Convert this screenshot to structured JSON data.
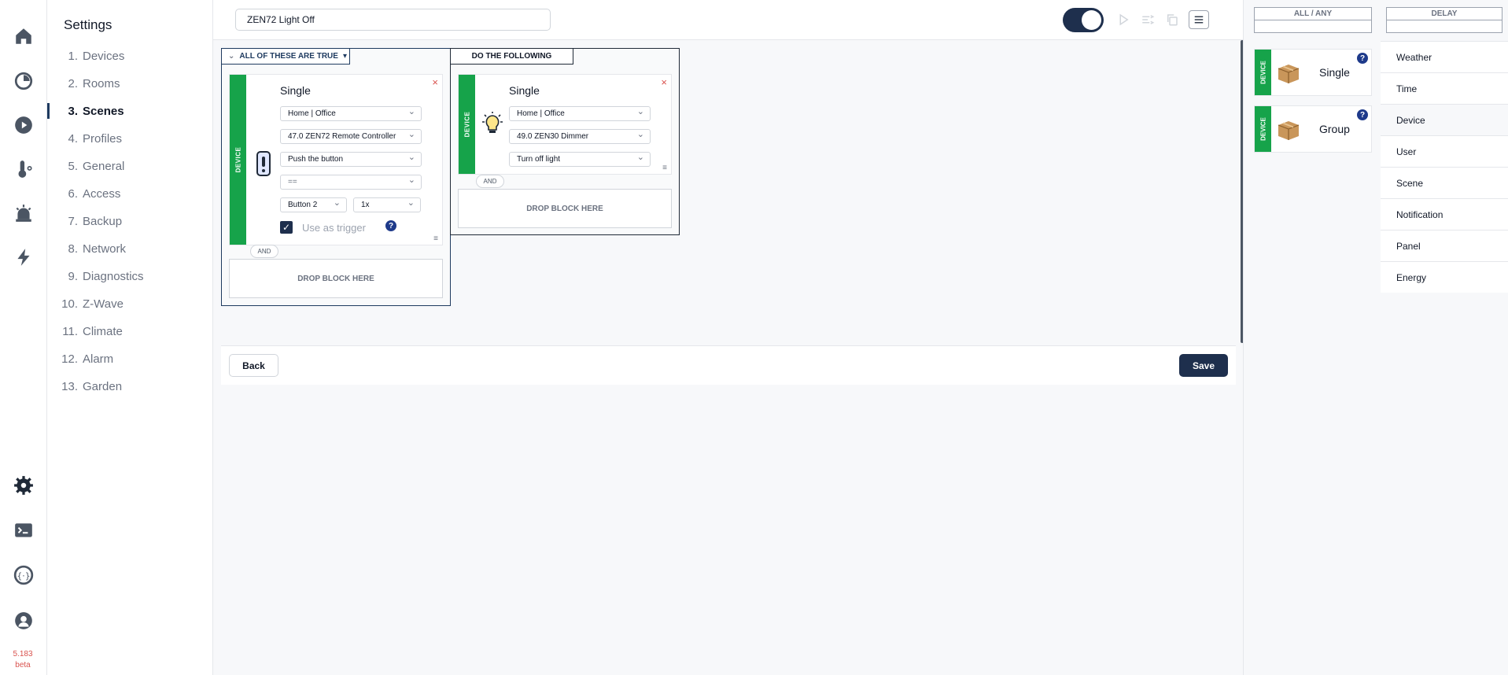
{
  "rail": {
    "version": "5.183",
    "version_tag": "beta",
    "icons": [
      "home-icon",
      "dashboard-icon",
      "play-icon",
      "thermometer-icon",
      "alarm-icon",
      "lightning-icon",
      "gear-icon",
      "terminal-icon",
      "api-icon",
      "user-icon"
    ]
  },
  "menu": {
    "title": "Settings",
    "items": [
      {
        "num": "1.",
        "label": "Devices"
      },
      {
        "num": "2.",
        "label": "Rooms"
      },
      {
        "num": "3.",
        "label": "Scenes"
      },
      {
        "num": "4.",
        "label": "Profiles"
      },
      {
        "num": "5.",
        "label": "General"
      },
      {
        "num": "6.",
        "label": "Access"
      },
      {
        "num": "7.",
        "label": "Backup"
      },
      {
        "num": "8.",
        "label": "Network"
      },
      {
        "num": "9.",
        "label": "Diagnostics"
      },
      {
        "num": "10.",
        "label": "Z-Wave"
      },
      {
        "num": "11.",
        "label": "Climate"
      },
      {
        "num": "12.",
        "label": "Alarm"
      },
      {
        "num": "13.",
        "label": "Garden"
      }
    ],
    "active_index": 2
  },
  "topbar": {
    "scene_name": "ZEN72 Light Off",
    "enabled": true
  },
  "conditions": {
    "header": "ALL OF THESE ARE TRUE",
    "card": {
      "strip": "DEVICE",
      "kind": "Single",
      "room": "Home | Office",
      "device": "47.0 ZEN72 Remote Controller",
      "property": "Push the button",
      "operator": "==",
      "button": "Button 2",
      "count": "1x",
      "trigger_label": "Use as trigger",
      "trigger_checked": true
    },
    "and_label": "AND",
    "drop_label": "DROP BLOCK HERE"
  },
  "actions": {
    "header": "DO THE FOLLOWING",
    "card": {
      "strip": "DEVICE",
      "kind": "Single",
      "room": "Home | Office",
      "device": "49.0 ZEN30 Dimmer",
      "action": "Turn off light"
    },
    "and_label": "AND",
    "drop_label": "DROP BLOCK HERE"
  },
  "footer": {
    "back_label": "Back",
    "save_label": "Save"
  },
  "palette": {
    "tab_all_any": "ALL / ANY",
    "tab_delay": "DELAY",
    "cards": [
      {
        "strip": "DEVICE",
        "name": "Single"
      },
      {
        "strip": "DEVICE",
        "name": "Group"
      }
    ],
    "categories": [
      "Weather",
      "Time",
      "Device",
      "User",
      "Scene",
      "Notification",
      "Panel",
      "Energy"
    ],
    "active_category": "Device"
  },
  "colors": {
    "accent": "#1e2f4d",
    "device_strip": "#16a34a",
    "close": "#d9534f",
    "version": "#d9534f"
  }
}
